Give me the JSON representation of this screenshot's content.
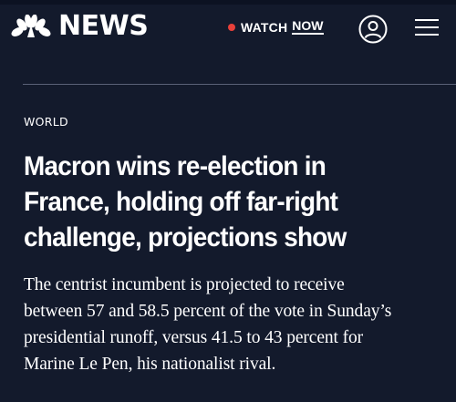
{
  "header": {
    "brand_name": "NEWS",
    "watch_label": "WATCH",
    "watch_now_label": "NOW",
    "live_dot_color": "#e8403a",
    "account_icon": "user-circle-icon",
    "menu_icon": "hamburger-menu-icon"
  },
  "article": {
    "category": "WORLD",
    "headline_lines": [
      "Macron wins re-election in",
      "France, holding off far-right",
      "challenge, projections show"
    ],
    "summary_lines": [
      "The centrist incumbent is projected to receive",
      "between 57 and 58.5 percent of the vote in Sunday’s",
      "presidential runoff, versus 41.5 to 43 percent for",
      "Marine Le Pen, his nationalist rival."
    ]
  },
  "colors": {
    "background": "#131a2c",
    "text": "#ffffff",
    "rule": "#5a6178"
  }
}
